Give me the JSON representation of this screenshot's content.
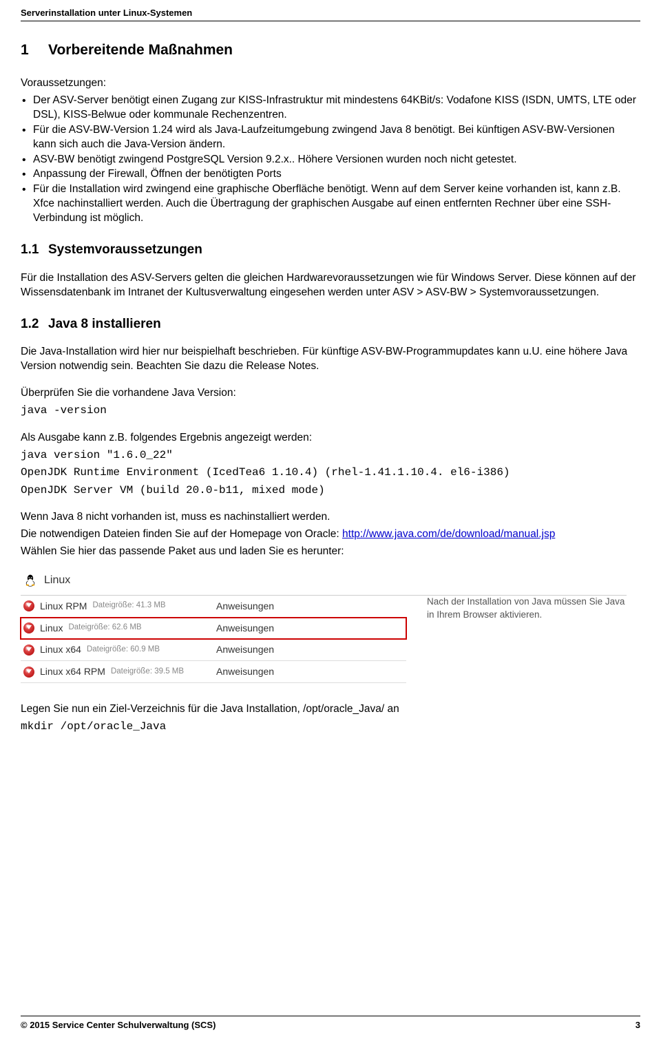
{
  "header": "Serverinstallation unter Linux-Systemen",
  "h1_num": "1",
  "h1_title": "Vorbereitende Maßnahmen",
  "prereq_label": "Voraussetzungen:",
  "bullets": [
    "Der ASV-Server benötigt einen Zugang zur KISS-Infrastruktur mit mindestens 64KBit/s: Vodafone KISS (ISDN, UMTS, LTE oder DSL), KISS-Belwue oder kommunale Rechenzentren.",
    "Für die ASV-BW-Version 1.24 wird als Java-Laufzeitumgebung zwingend Java 8 benötigt. Bei künftigen ASV-BW-Versionen kann sich auch die Java-Version ändern.",
    "ASV-BW benötigt zwingend PostgreSQL Version 9.2.x.. Höhere Versionen wurden noch nicht getestet.",
    "Anpassung der Firewall, Öffnen der benötigten Ports",
    "Für die Installation wird zwingend eine graphische Oberfläche benötigt. Wenn auf dem Server keine vorhanden ist, kann z.B. Xfce nachinstalliert werden. Auch die Übertragung der graphischen Ausgabe auf einen entfernten Rechner über eine SSH-Verbindung ist möglich."
  ],
  "h11_num": "1.1",
  "h11_title": "Systemvoraussetzungen",
  "p11": "Für die Installation des ASV-Servers gelten die gleichen Hardwarevoraussetzungen wie für Windows Server. Diese können auf der Wissensdatenbank im Intranet der Kultusverwaltung eingesehen werden unter ASV > ASV-BW > Systemvoraussetzungen.",
  "h12_num": "1.2",
  "h12_title": "Java 8 installieren",
  "p12a": "Die Java-Installation wird hier nur beispielhaft beschrieben. Für künftige ASV-BW-Programmupdates kann u.U. eine höhere Java Version notwendig sein. Beachten Sie dazu die Release Notes.",
  "p12b": "Überprüfen Sie die vorhandene Java Version:",
  "cmd1": "java -version",
  "p12c": "Als Ausgabe kann z.B. folgendes Ergebnis angezeigt werden:",
  "out1": "java version \"1.6.0_22\"",
  "out2": "OpenJDK Runtime Environment (IcedTea6 1.10.4) (rhel-1.41.1.10.4. el6-i386)",
  "out3": "OpenJDK Server VM (build 20.0-b11, mixed mode)",
  "p12d": "Wenn Java 8 nicht vorhanden ist, muss es nachinstalliert werden.",
  "p12e_a": "Die notwendigen Dateien finden Sie auf der Homepage von Oracle: ",
  "p12e_link": "http://www.java.com/de/download/manual.jsp",
  "p12f": "Wählen Sie hier das passende Paket aus und laden Sie es herunter:",
  "dl": {
    "os": "Linux",
    "note": "Nach der Installation von Java müssen Sie Java in Ihrem Browser aktivieren.",
    "rows": [
      {
        "name": "Linux RPM",
        "size": "Dateigröße: 41.3 MB",
        "link": "Anweisungen",
        "hl": false
      },
      {
        "name": "Linux",
        "size": "Dateigröße: 62.6 MB",
        "link": "Anweisungen",
        "hl": true
      },
      {
        "name": "Linux x64",
        "size": "Dateigröße: 60.9 MB",
        "link": "Anweisungen",
        "hl": false
      },
      {
        "name": "Linux x64 RPM",
        "size": "Dateigröße: 39.5 MB",
        "link": "Anweisungen",
        "hl": false
      }
    ]
  },
  "p_after": "Legen Sie nun ein Ziel-Verzeichnis für die Java Installation, /opt/oracle_Java/ an",
  "cmd2": "mkdir /opt/oracle_Java",
  "footer_left": "© 2015 Service Center Schulverwaltung (SCS)",
  "footer_right": "3"
}
